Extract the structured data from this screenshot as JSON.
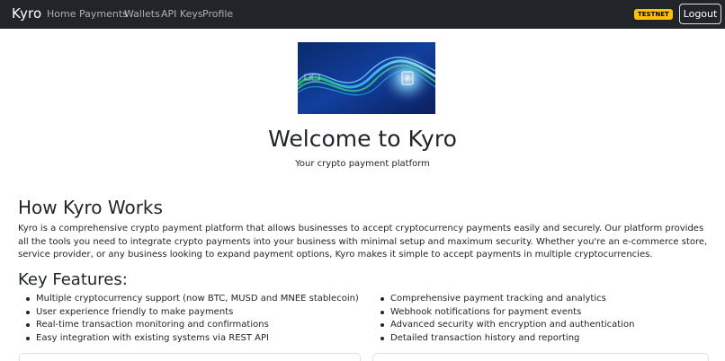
{
  "navbar": {
    "brand": "Kyro",
    "links": [
      "Home",
      "Payments",
      "Wallets",
      "API Keys",
      "Profile"
    ],
    "badge": "TESTNET",
    "logout_label": "Logout"
  },
  "hero": {
    "image_icon": "data-wave-banner",
    "title": "Welcome to Kyro",
    "subtitle": "Your crypto payment platform"
  },
  "how_it_works": {
    "title": "How Kyro Works",
    "description": "Kyro is a comprehensive crypto payment platform that allows businesses to accept cryptocurrency payments easily and securely. Our platform provides all the tools you need to integrate crypto payments into your business with minimal setup and maximum security. Whether you're an e-commerce store, service provider, or any business looking to expand payment options, Kyro makes it simple to accept payments in multiple cryptocurrencies."
  },
  "features": {
    "title": "Key Features:",
    "left": [
      "Multiple cryptocurrency support (now BTC, MUSD and MNEE stablecoin)",
      "User experience friendly to make payments",
      "Real-time transaction monitoring and confirmations",
      "Easy integration with existing systems via REST API"
    ],
    "right": [
      "Comprehensive payment tracking and analytics",
      "Webhook notifications for payment events",
      "Advanced security with encryption and authentication",
      "Detailed transaction history and reporting"
    ]
  },
  "colors": {
    "navbar_bg": "#212529",
    "badge_bg": "#ffc107",
    "text": "#212529"
  }
}
